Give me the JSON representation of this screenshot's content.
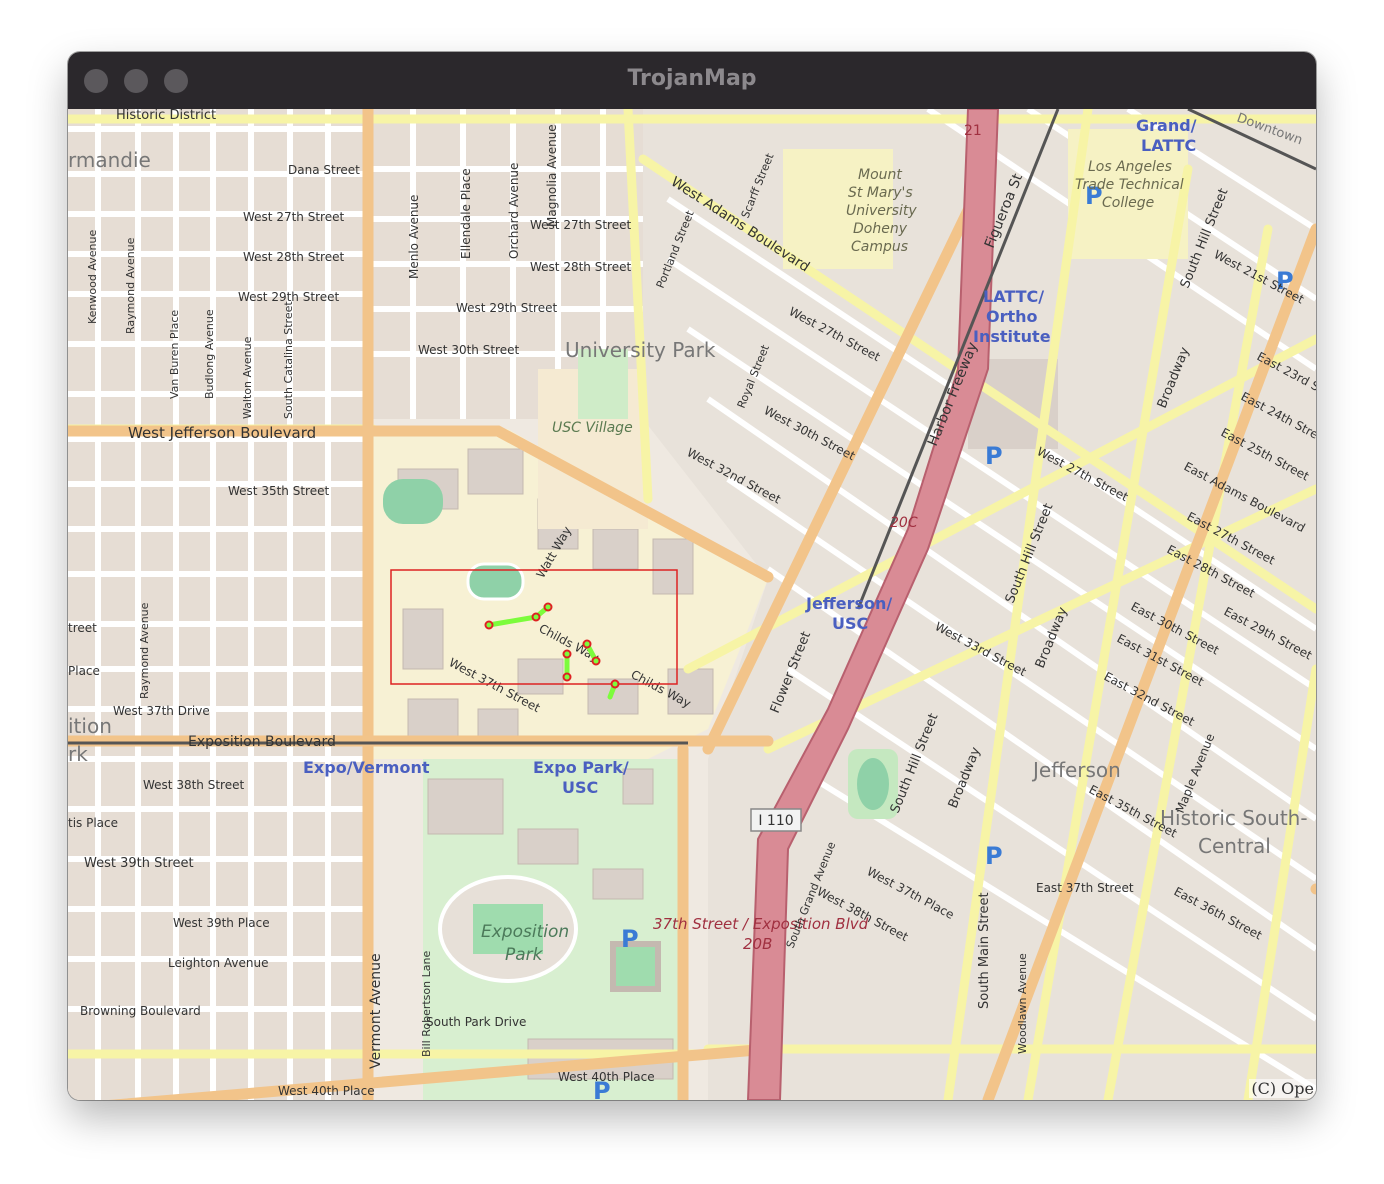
{
  "window": {
    "title": "TrojanMap"
  },
  "map": {
    "attribution": "(C) Ope",
    "labels": {
      "historic_district": "Historic District",
      "rmandie": "rmandie",
      "dana_st": "Dana Street",
      "w27": "West 27th Street",
      "w28": "West 28th Street",
      "w29": "West 29th Street",
      "w27_b": "West 27th Street",
      "w28_b": "West 28th Street",
      "w29_b": "West 29th Street",
      "w30": "West 30th Street",
      "university_park": "University Park",
      "usc_village": "USC Village",
      "jefferson_blvd": "West Jefferson Boulevard",
      "w35": "West 35th Street",
      "w37_drive": "West 37th Drive",
      "expo_blvd": "Exposition Boulevard",
      "expo_vermont": "Expo/Vermont",
      "expo_park_usc_1": "Expo Park/",
      "expo_park_usc_2": "USC",
      "w38": "West 38th Street",
      "w39": "West 39th Street",
      "w39_place": "West 39th Place",
      "leighton": "Leighton Avenue",
      "browning": "Browning Boulevard",
      "w40_place": "West 40th Place",
      "w40_place_b": "West 40th Place",
      "south_park_drive": "South Park Drive",
      "vermont_ave": "Vermont Avenue",
      "bill_robertson": "Bill Robertson Lane",
      "exposition_park_1": "Exposition",
      "exposition_park_2": "Park",
      "expo_37th_1": "37th Street / Exposition Blvd",
      "expo_37th_2": "20B",
      "i110": "I 110",
      "jefferson_usc_1": "Jefferson/",
      "jefferson_usc_2": "USC",
      "jefferson_area": "Jefferson",
      "historic_south_1": "Historic South-",
      "historic_south_2": "Central",
      "lattc_1": "LATTC/",
      "lattc_2": "Ortho",
      "lattc_3": "Institute",
      "grand_lattc_1": "Grand/",
      "grand_lattc_2": "LATTC",
      "la_trade_1": "Los Angeles",
      "la_trade_2": "Trade Technical",
      "la_trade_3": "College",
      "mount_st_mary_1": "Mount",
      "mount_st_mary_2": "St Mary's",
      "mount_st_mary_3": "University",
      "mount_st_mary_4": "Doheny",
      "mount_st_mary_5": "Campus",
      "west_adams": "West Adams Boulevard",
      "harbor_fwy": "Harbor Freeway",
      "figueroa": "Figueroa St",
      "e21": "21",
      "e20c": "20C",
      "downtown": "Downtown",
      "south_hill_st": "South Hill Street",
      "broadway": "Broadway",
      "flower_st": "Flower Street",
      "south_main": "South Main Street",
      "w33": "West 33rd Street",
      "w37_street": "West 37th Street",
      "childs_way": "Childs Way",
      "watt_way": "Watt Way",
      "w27_east": "West 27th Street",
      "w30_east": "West 30th Street",
      "w32": "West 32nd Street",
      "w37_place": "West 37th Place",
      "w38_east": "West 38th Street",
      "e37": "East 37th Street",
      "e36": "East 36th Street",
      "e35": "East 35th Street",
      "maple": "Maple Avenue",
      "e30": "East 30th Street",
      "e31": "East 31st Street",
      "e32": "East 32nd Street",
      "w21": "West 21st Street",
      "e23": "East 23rd St",
      "e24": "East 24th Stree",
      "e25": "East 25th Street",
      "e_adams": "East Adams Boulevard",
      "e27": "East 27th Street",
      "e28": "East 28th Street",
      "e29": "East 29th Street",
      "w27_far": "West 27th Street",
      "menlo": "Menlo Avenue",
      "ellendale": "Ellendale Place",
      "orchard": "Orchard Avenue",
      "magnolia": "Magnolia Avenue",
      "kenwood": "Kenwood Avenue",
      "raymond": "Raymond Avenue",
      "van_buren": "Van Buren Place",
      "budlong": "Budlong Avenue",
      "walton": "Walton Avenue",
      "catalina": "South Catalina Street",
      "portland": "Portland Street",
      "scarff": "Scarff Street",
      "royal": "Royal Street",
      "grand_ave": "South Grand Avenue",
      "woodlawn": "Woodlawn Avenue",
      "ition": "ition",
      "rk": "rk",
      "tis_place": "tis Place",
      "street_frag": "treet",
      "place_frag": "Place",
      "parking": "P"
    }
  },
  "route_colors": {
    "path": "#7cfc3c",
    "node": "#dd2222",
    "box": "#dd2222"
  }
}
